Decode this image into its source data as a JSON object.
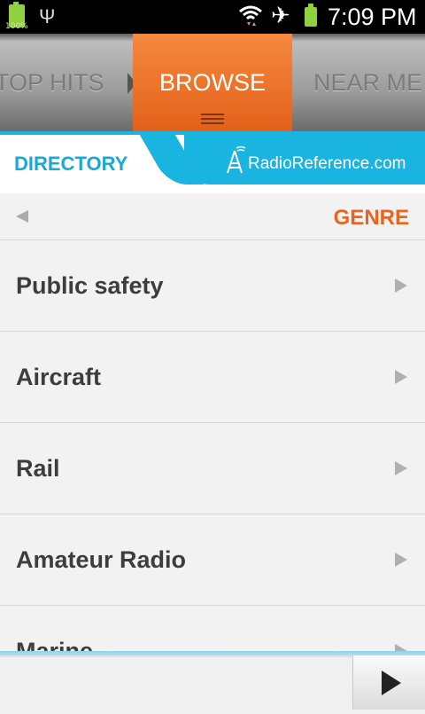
{
  "status_bar": {
    "battery_left_percent": "100%",
    "time": "7:09 PM",
    "icons": [
      "battery-icon",
      "usb-icon",
      "wifi-icon",
      "airplane-icon",
      "battery-icon"
    ]
  },
  "tabs": {
    "left": "TOP HITS",
    "active": "BROWSE",
    "right": "NEAR ME"
  },
  "directory": {
    "title": "DIRECTORY",
    "brand": "RadioReference.com"
  },
  "nav": {
    "title": "GENRE"
  },
  "list": {
    "items": [
      {
        "label": "Public safety"
      },
      {
        "label": "Aircraft"
      },
      {
        "label": "Rail"
      },
      {
        "label": "Amateur Radio"
      },
      {
        "label": "Marine"
      }
    ]
  },
  "colors": {
    "accent_orange": "#e8651f",
    "accent_blue": "#19b4e0"
  }
}
